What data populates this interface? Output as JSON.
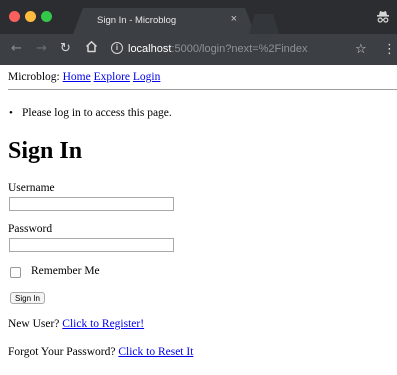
{
  "browser": {
    "tab_title": "Sign In - Microblog",
    "tab_close": "×",
    "url_host": "localhost",
    "url_rest": ":5000/login?next=%2Findex"
  },
  "nav": {
    "brand": "Microblog:",
    "links": [
      "Home",
      "Explore",
      "Login"
    ]
  },
  "flash_message": "Please log in to access this page.",
  "form": {
    "heading": "Sign In",
    "username_label": "Username",
    "username_value": "",
    "password_label": "Password",
    "password_value": "",
    "remember_label": "Remember Me",
    "remember_checked": false,
    "submit_label": "Sign In"
  },
  "register": {
    "prefix": "New User?",
    "link": "Click to Register!"
  },
  "reset": {
    "prefix": "Forgot Your Password?",
    "link": "Click to Reset It"
  },
  "icons": {
    "back": "back-arrow-icon",
    "forward": "forward-arrow-icon",
    "reload": "reload-icon",
    "home": "home-icon",
    "info": "info-icon",
    "bookmark": "star-icon",
    "menu": "kebab-menu-icon",
    "profile": "incognito-icon"
  },
  "colors": {
    "link": "#0000ee",
    "chrome_dark": "#2b2d30",
    "toolbar": "#3c3f43",
    "close": "#fc605c",
    "minimize": "#fdbc40",
    "maximize": "#34c84a"
  }
}
